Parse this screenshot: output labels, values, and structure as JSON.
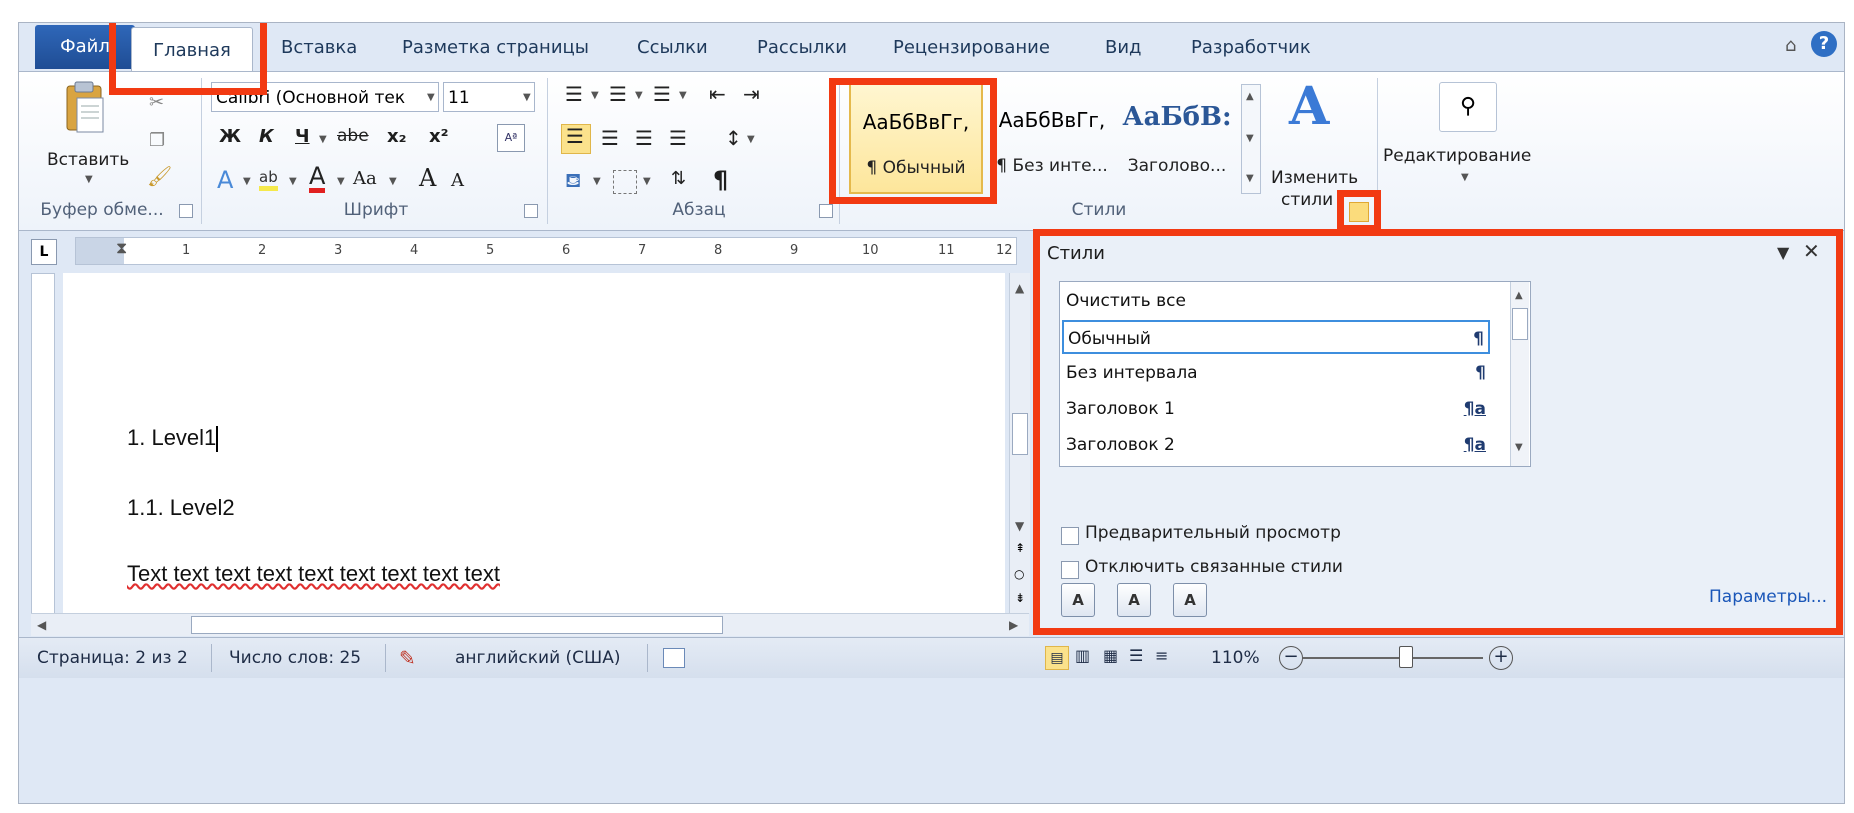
{
  "tabs": [
    "Файл",
    "Главная",
    "Вставка",
    "Разметка страницы",
    "Ссылки",
    "Рассылки",
    "Рецензирование",
    "Вид",
    "Разработчик"
  ],
  "help_glyph": "?",
  "clipboard": {
    "paste_label": "Вставить",
    "group_label": "Буфер обме..."
  },
  "font": {
    "name": "Calibri (Основной тек",
    "size": "11",
    "group_label": "Шрифт",
    "bold": "Ж",
    "italic": "К",
    "underline": "Ч",
    "strike": "abe",
    "sub": "x₂",
    "sup": "x²",
    "fontcolor_letter": "A",
    "case": "Aa",
    "grow": "A",
    "shrink": "A"
  },
  "paragraph": {
    "group_label": "Абзац",
    "pilcrow": "¶"
  },
  "styles": {
    "group_label": "Стили",
    "tiles": [
      {
        "preview": "АаБбВвГг,",
        "name": "¶ Обычный"
      },
      {
        "preview": "АаБбВвГг,",
        "name": "¶ Без инте..."
      },
      {
        "preview": "АаБбВ:",
        "name": "Заголово..."
      }
    ],
    "change_label_1": "Изменить",
    "change_label_2": "стили"
  },
  "editing": {
    "label": "Редактирование"
  },
  "ruler": {
    "numbers": [
      "1",
      "2",
      "3",
      "4",
      "5",
      "6",
      "7",
      "8",
      "9",
      "10",
      "11",
      "12"
    ]
  },
  "document": {
    "lines": [
      "1. Level1",
      "1.1. Level2",
      "Text text text text text text text text text"
    ]
  },
  "pane": {
    "title": "Стили",
    "items": [
      {
        "name": "Очистить все",
        "mark": ""
      },
      {
        "name": "Обычный",
        "mark": "¶"
      },
      {
        "name": "Без интервала",
        "mark": "¶"
      },
      {
        "name": "Заголовок 1",
        "mark": "¶a"
      },
      {
        "name": "Заголовок 2",
        "mark": "¶a"
      }
    ],
    "preview_label": "Предварительный просмотр",
    "disable_linked_label": "Отключить связанные стили",
    "params_link": "Параметры..."
  },
  "status": {
    "page": "Страница: 2 из 2",
    "words": "Число слов: 25",
    "language": "английский (США)",
    "zoom": "110%"
  },
  "colors": {
    "accent_red": "#f23a12",
    "file_tab": "#2a5ea9",
    "link": "#1a56b8"
  }
}
